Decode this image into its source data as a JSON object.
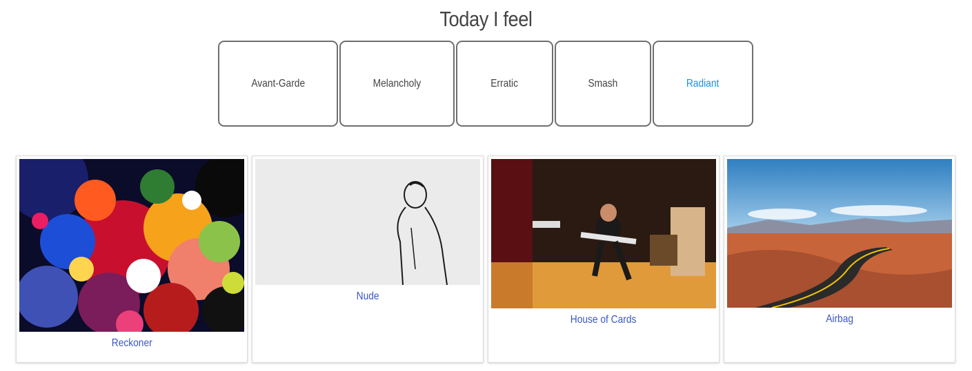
{
  "header": {
    "title": "Today I feel"
  },
  "moods": [
    {
      "label": "Avant-Garde",
      "active": false
    },
    {
      "label": "Melancholy",
      "active": false
    },
    {
      "label": "Erratic",
      "active": false
    },
    {
      "label": "Smash",
      "active": false
    },
    {
      "label": "Radiant",
      "active": true
    }
  ],
  "cards": [
    {
      "title": "Reckoner",
      "image": "abstract-painting"
    },
    {
      "title": "Nude",
      "image": "sketch-figure"
    },
    {
      "title": "House of Cards",
      "image": "guitarist-studio"
    },
    {
      "title": "Airbag",
      "image": "desert-road"
    }
  ],
  "colors": {
    "active_mood": "#1a8fe0",
    "link": "#3b55c9",
    "text": "#444444"
  }
}
